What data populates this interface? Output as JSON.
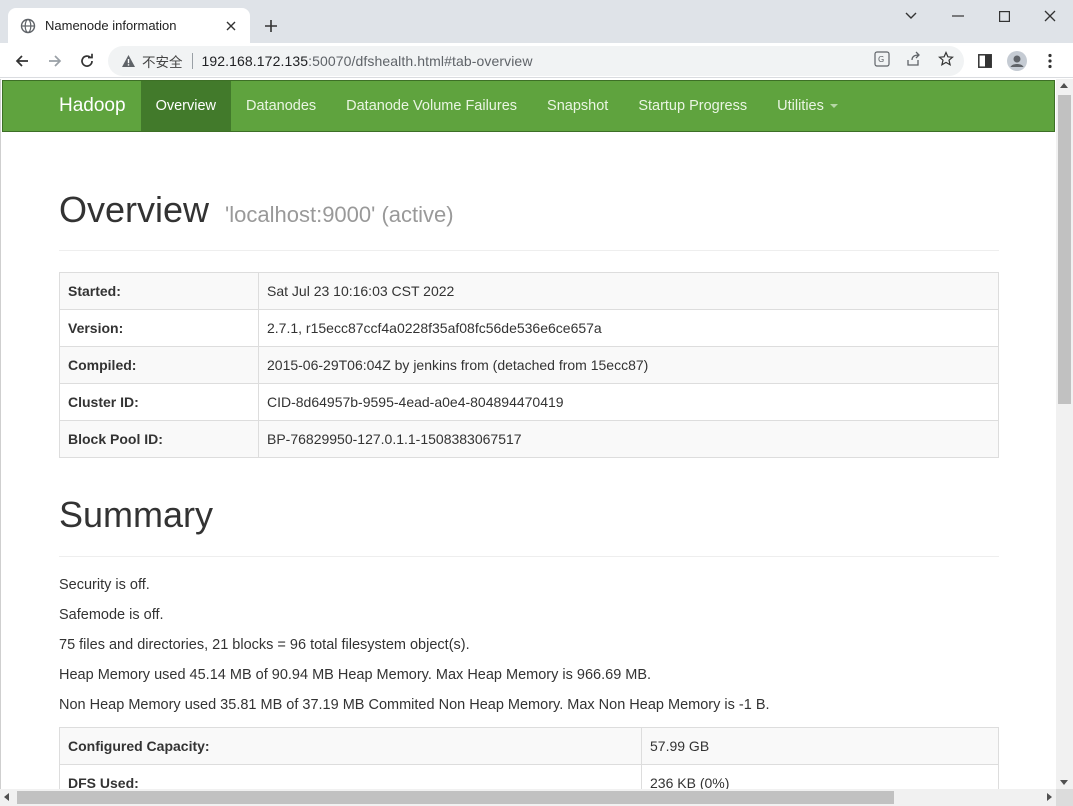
{
  "browser": {
    "tab_title": "Namenode information",
    "insecure_label": "不安全",
    "url_host": "192.168.172.135",
    "url_rest": ":50070/dfshealth.html#tab-overview"
  },
  "navbar": {
    "brand": "Hadoop",
    "items": [
      {
        "label": "Overview",
        "active": true
      },
      {
        "label": "Datanodes"
      },
      {
        "label": "Datanode Volume Failures"
      },
      {
        "label": "Snapshot"
      },
      {
        "label": "Startup Progress"
      },
      {
        "label": "Utilities"
      }
    ],
    "accent_color": "#5fa33e"
  },
  "overview": {
    "title": "Overview",
    "subtitle": "'localhost:9000' (active)",
    "rows": [
      {
        "key": "Started:",
        "value": "Sat Jul 23 10:16:03 CST 2022"
      },
      {
        "key": "Version:",
        "value": "2.7.1, r15ecc87ccf4a0228f35af08fc56de536e6ce657a"
      },
      {
        "key": "Compiled:",
        "value": "2015-06-29T06:04Z by jenkins from (detached from 15ecc87)"
      },
      {
        "key": "Cluster ID:",
        "value": "CID-8d64957b-9595-4ead-a0e4-804894470419"
      },
      {
        "key": "Block Pool ID:",
        "value": "BP-76829950-127.0.1.1-1508383067517"
      }
    ]
  },
  "summary": {
    "title": "Summary",
    "lines": [
      "Security is off.",
      "Safemode is off.",
      "75 files and directories, 21 blocks = 96 total filesystem object(s).",
      "Heap Memory used 45.14 MB of 90.94 MB Heap Memory. Max Heap Memory is 966.69 MB.",
      "Non Heap Memory used 35.81 MB of 37.19 MB Commited Non Heap Memory. Max Non Heap Memory is -1 B."
    ],
    "rows": [
      {
        "key": "Configured Capacity:",
        "value": "57.99 GB"
      },
      {
        "key": "DFS Used:",
        "value": "236 KB (0%)"
      }
    ]
  }
}
